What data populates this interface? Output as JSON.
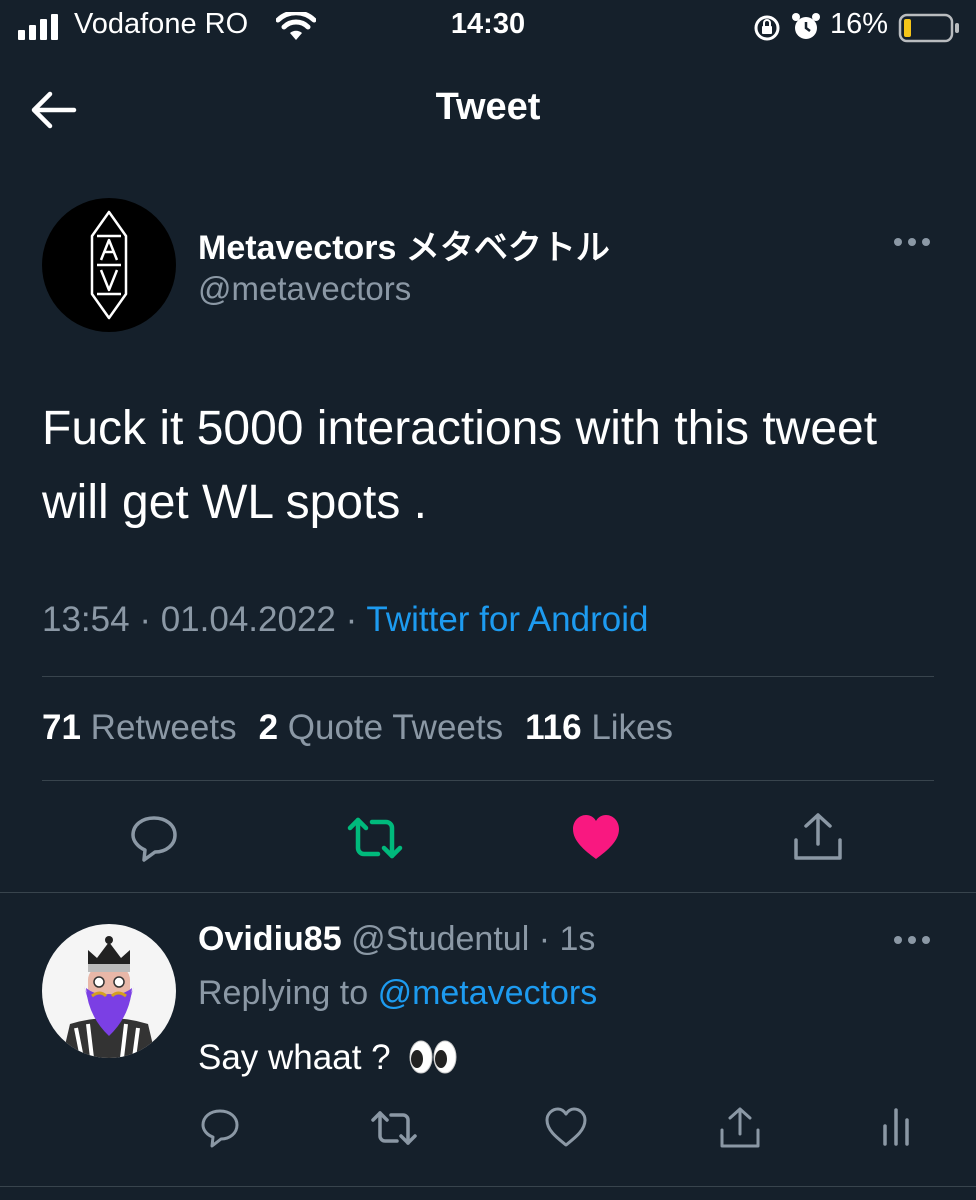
{
  "status_bar": {
    "carrier": "Vodafone RO",
    "time": "14:30",
    "battery": "16%"
  },
  "header": {
    "title": "Tweet"
  },
  "tweet": {
    "display_name": "Metavectors メタベクトル",
    "handle": "@metavectors",
    "text": "Fuck it 5000 interactions with this tweet will get WL spots .",
    "time": "13:54",
    "date": "01.04.2022",
    "source": "Twitter for Android",
    "stats": {
      "retweets_count": "71",
      "retweets_label": "Retweets",
      "quotes_count": "2",
      "quotes_label": "Quote Tweets",
      "likes_count": "116",
      "likes_label": "Likes"
    },
    "liked": true,
    "retweeted": true
  },
  "reply": {
    "display_name": "Ovidiu85",
    "handle": "@Studentul",
    "age": "1s",
    "replying_label": "Replying to",
    "replying_handle": "@metavectors",
    "text": "Say whaat ?"
  },
  "colors": {
    "background": "#15202b",
    "link": "#1d9bf0",
    "like": "#f91880",
    "retweet": "#00ba7c",
    "muted": "#8b98a5"
  }
}
